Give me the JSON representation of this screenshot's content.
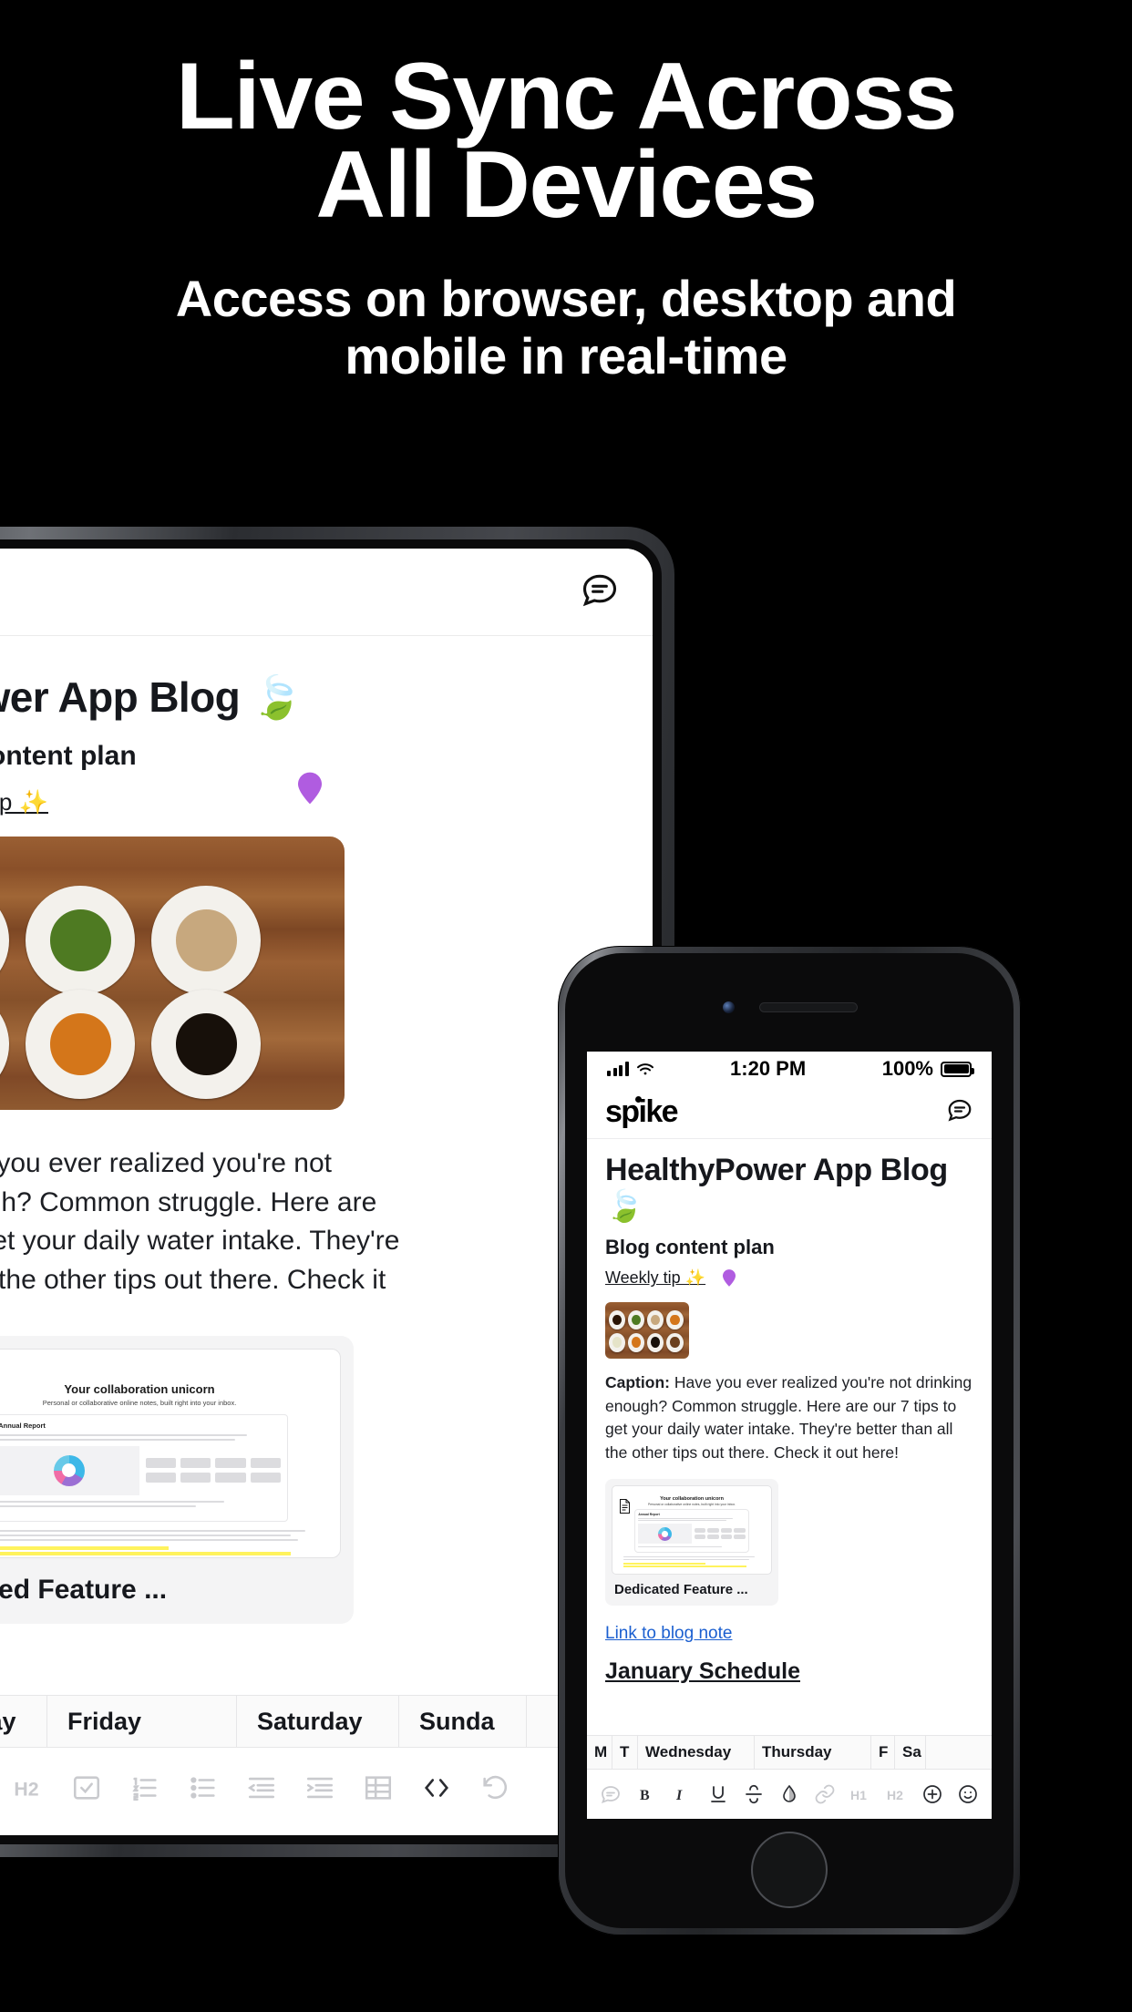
{
  "hero": {
    "title_line1": "Live Sync Across",
    "title_line2": "All Devices",
    "subtitle_line1": "Access on browser, desktop and",
    "subtitle_line2": "mobile in real-time"
  },
  "desktop": {
    "chat_icon": "chat-bubble-icon",
    "note_title": "Power App Blog 🍃",
    "note_subtitle": "log content plan",
    "note_link": "eekly tip ✨",
    "pin_icon": "location-pin-icon",
    "photo_alt": "sauces-in-bowls-photo",
    "paragraph_lines": [
      "Have you ever realized you're not",
      "enough? Common struggle. Here are",
      "s to get your daily water intake. They're",
      "an all the other tips out there. Check it"
    ],
    "card": {
      "preview_title": "Your collaboration unicorn",
      "preview_subtitle": "Personal or collaborative online notes, built right into your inbox.",
      "preview_doc_label": "Annual Report",
      "title": "licated Feature ..."
    },
    "table_headers": [
      "Thursday",
      "Friday",
      "Saturday",
      "Sunda"
    ],
    "toolbar_icons": [
      "link-icon",
      "heading-1-icon",
      "heading-2-icon",
      "checklist-icon",
      "ordered-list-icon",
      "bulleted-list-icon",
      "outdent-icon",
      "indent-icon",
      "table-icon",
      "code-icon",
      "undo-icon",
      "add-icon",
      "emoji-icon"
    ]
  },
  "phone": {
    "status": {
      "time": "1:20 PM",
      "battery": "100%",
      "signal_icon": "signal-bars-icon",
      "wifi_icon": "wifi-icon",
      "battery_icon": "battery-full-icon"
    },
    "appbar": {
      "logo": "spike",
      "chat_icon": "chat-bubble-icon"
    },
    "note_title": "HealthyPower App Blog 🍃",
    "note_subtitle": "Blog content plan",
    "note_link": "Weekly tip ✨",
    "pin_icon": "location-pin-icon",
    "photo_alt": "sauces-in-bowls-photo",
    "caption_label": "Caption:",
    "caption_text": " Have you ever realized you're not drinking enough? Common struggle. Here are our 7 tips to get your daily water intake. They're better than all the other tips out there. Check it out here!",
    "card": {
      "preview_title": "Your collaboration unicorn",
      "preview_subtitle": "Personal or collaborative online notes, built right into your inbox.",
      "preview_doc_label": "Annual Report",
      "title": "Dedicated Feature ..."
    },
    "blog_link": "Link to blog note",
    "schedule_title": "January Schedule",
    "table_headers": [
      "M",
      "T",
      "Wednesday",
      "Thursday",
      "F",
      "Sa"
    ],
    "toolbar_icons": [
      "comment-icon",
      "bold-icon",
      "italic-icon",
      "underline-icon",
      "strikethrough-icon",
      "highlight-icon",
      "link-icon",
      "heading-1-icon",
      "heading-2-icon",
      "add-icon",
      "emoji-icon"
    ]
  },
  "colors": {
    "background": "#000000",
    "text_light": "#ffffff",
    "link_blue": "#1b5fd0",
    "pin_purple": "#b05ce0",
    "highlight_yellow": "#fff35c"
  }
}
